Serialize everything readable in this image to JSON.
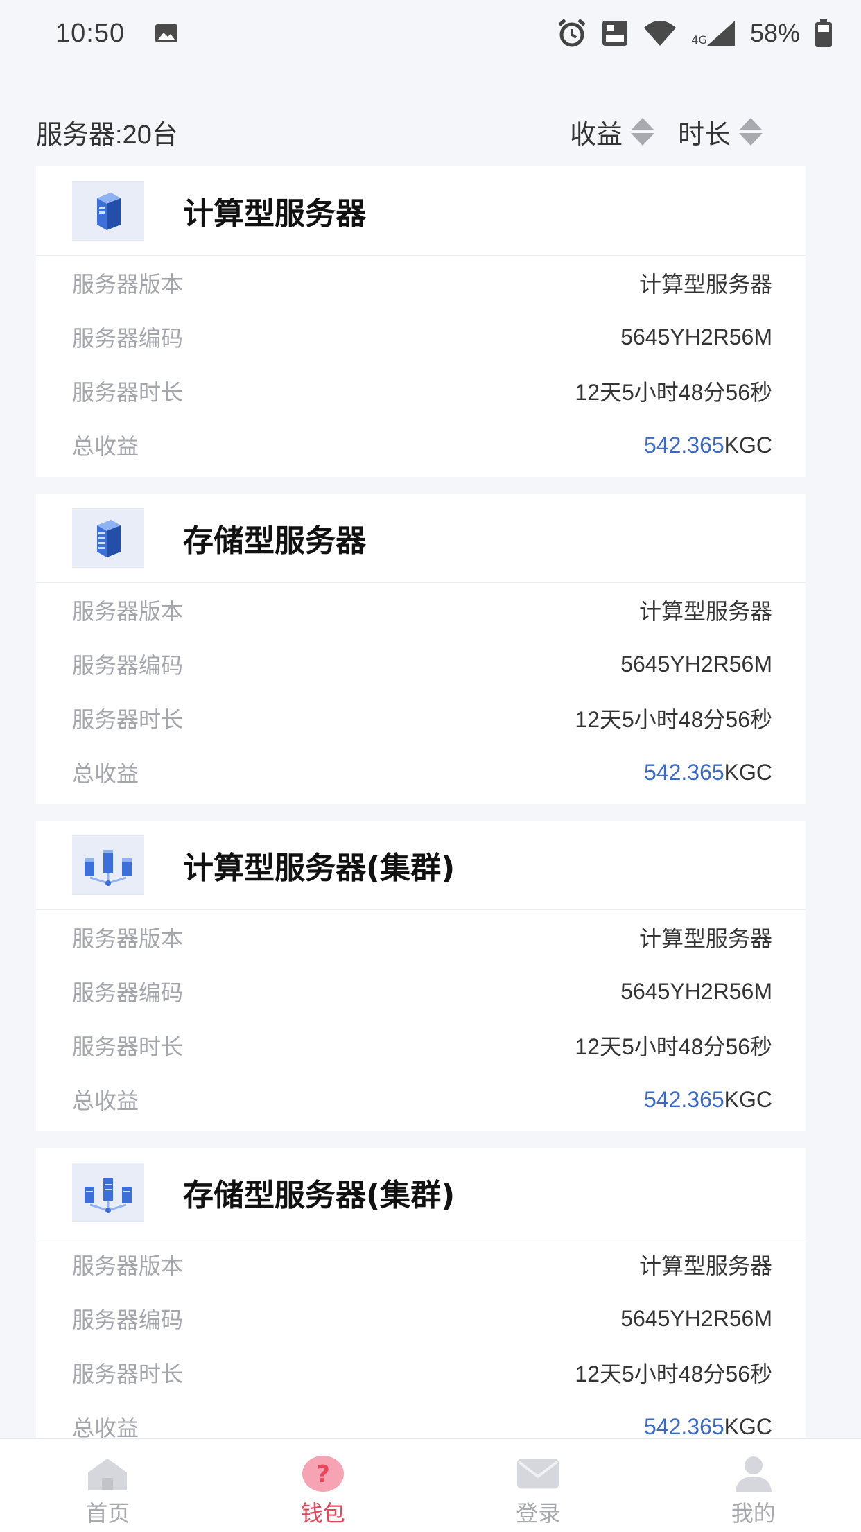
{
  "status_bar": {
    "time": "10:50",
    "battery": "58%",
    "network": "4G",
    "icons": [
      "image-icon",
      "alarm-icon",
      "volte-icon",
      "wifi-icon",
      "signal-icon",
      "battery-icon"
    ]
  },
  "header": {
    "server_count": "服务器:20台",
    "sort_income": "收益",
    "sort_duration": "时长"
  },
  "cards": [
    {
      "title": "计算型服务器",
      "icon": "server-icon",
      "version_label": "服务器版本",
      "version": "计算型服务器",
      "code_label": "服务器编码",
      "code": "5645YH2R56M",
      "duration_label": "服务器时长",
      "duration": "12天5小时48分56秒",
      "income_label": "总收益",
      "income_amount": "542.365",
      "income_unit": "KGC"
    },
    {
      "title": "存储型服务器",
      "icon": "storage-server-icon",
      "version_label": "服务器版本",
      "version": "计算型服务器",
      "code_label": "服务器编码",
      "code": "5645YH2R56M",
      "duration_label": "服务器时长",
      "duration": "12天5小时48分56秒",
      "income_label": "总收益",
      "income_amount": "542.365",
      "income_unit": "KGC"
    },
    {
      "title": "计算型服务器(集群)",
      "icon": "server-cluster-icon",
      "version_label": "服务器版本",
      "version": "计算型服务器",
      "code_label": "服务器编码",
      "code": "5645YH2R56M",
      "duration_label": "服务器时长",
      "duration": "12天5小时48分56秒",
      "income_label": "总收益",
      "income_amount": "542.365",
      "income_unit": "KGC"
    },
    {
      "title": "存储型服务器(集群)",
      "icon": "storage-cluster-icon",
      "version_label": "服务器版本",
      "version": "计算型服务器",
      "code_label": "服务器编码",
      "code": "5645YH2R56M",
      "duration_label": "服务器时长",
      "duration": "12天5小时48分56秒",
      "income_label": "总收益",
      "income_amount": "542.365",
      "income_unit": "KGC"
    }
  ],
  "tabs": [
    {
      "label": "首页",
      "icon": "home-icon"
    },
    {
      "label": "钱包",
      "icon": "question-icon",
      "active": true
    },
    {
      "label": "登录",
      "icon": "mail-icon"
    },
    {
      "label": "我的",
      "icon": "user-icon"
    }
  ],
  "colors": {
    "accent": "#e8445a",
    "amount": "#3a69c8",
    "label": "#a4a6ac",
    "background": "#f5f6fa"
  }
}
